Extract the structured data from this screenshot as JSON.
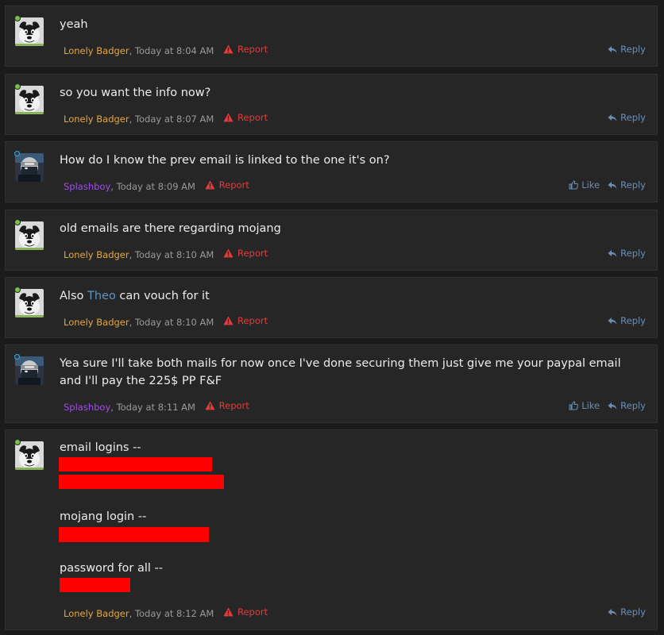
{
  "common": {
    "report_label": "Report",
    "reply_label": "Reply",
    "like_label": "Like"
  },
  "colors": {
    "background": "#1b1b1b",
    "post_bg": "#262626",
    "author_badger": "#e7a83a",
    "author_splash": "#a24cf0",
    "report": "#e23c3c",
    "action_link": "#6a8fb6",
    "mention": "#5f93c4",
    "redaction": "#ff0000"
  },
  "posts": [
    {
      "author": "Lonely Badger",
      "time": ", Today at 8:04 AM",
      "text": "yeah"
    },
    {
      "author": "Lonely Badger",
      "time": ", Today at 8:07 AM",
      "text": "so you want the info now?"
    },
    {
      "author": "Splashboy",
      "time": ", Today at 8:09 AM",
      "text": "How do I know the prev email is linked to the one it's on?"
    },
    {
      "author": "Lonely Badger",
      "time": ", Today at 8:10 AM",
      "text": "old emails are there regarding mojang"
    },
    {
      "author": "Lonely Badger",
      "time": ", Today at 8:10 AM",
      "text_before": "Also ",
      "mention": "Theo",
      "text_after": " can vouch for it"
    },
    {
      "author": "Splashboy",
      "time": ", Today at 8:11 AM",
      "text": "Yea sure I'll take both mails for now once I've done securing them just give me your paypal email and I'll pay the 225$ PP F&F"
    },
    {
      "author": "Lonely Badger",
      "time": ", Today at 8:12 AM",
      "line1": "email logins --",
      "line2": "mojang login --",
      "line3": "password for all --"
    }
  ]
}
